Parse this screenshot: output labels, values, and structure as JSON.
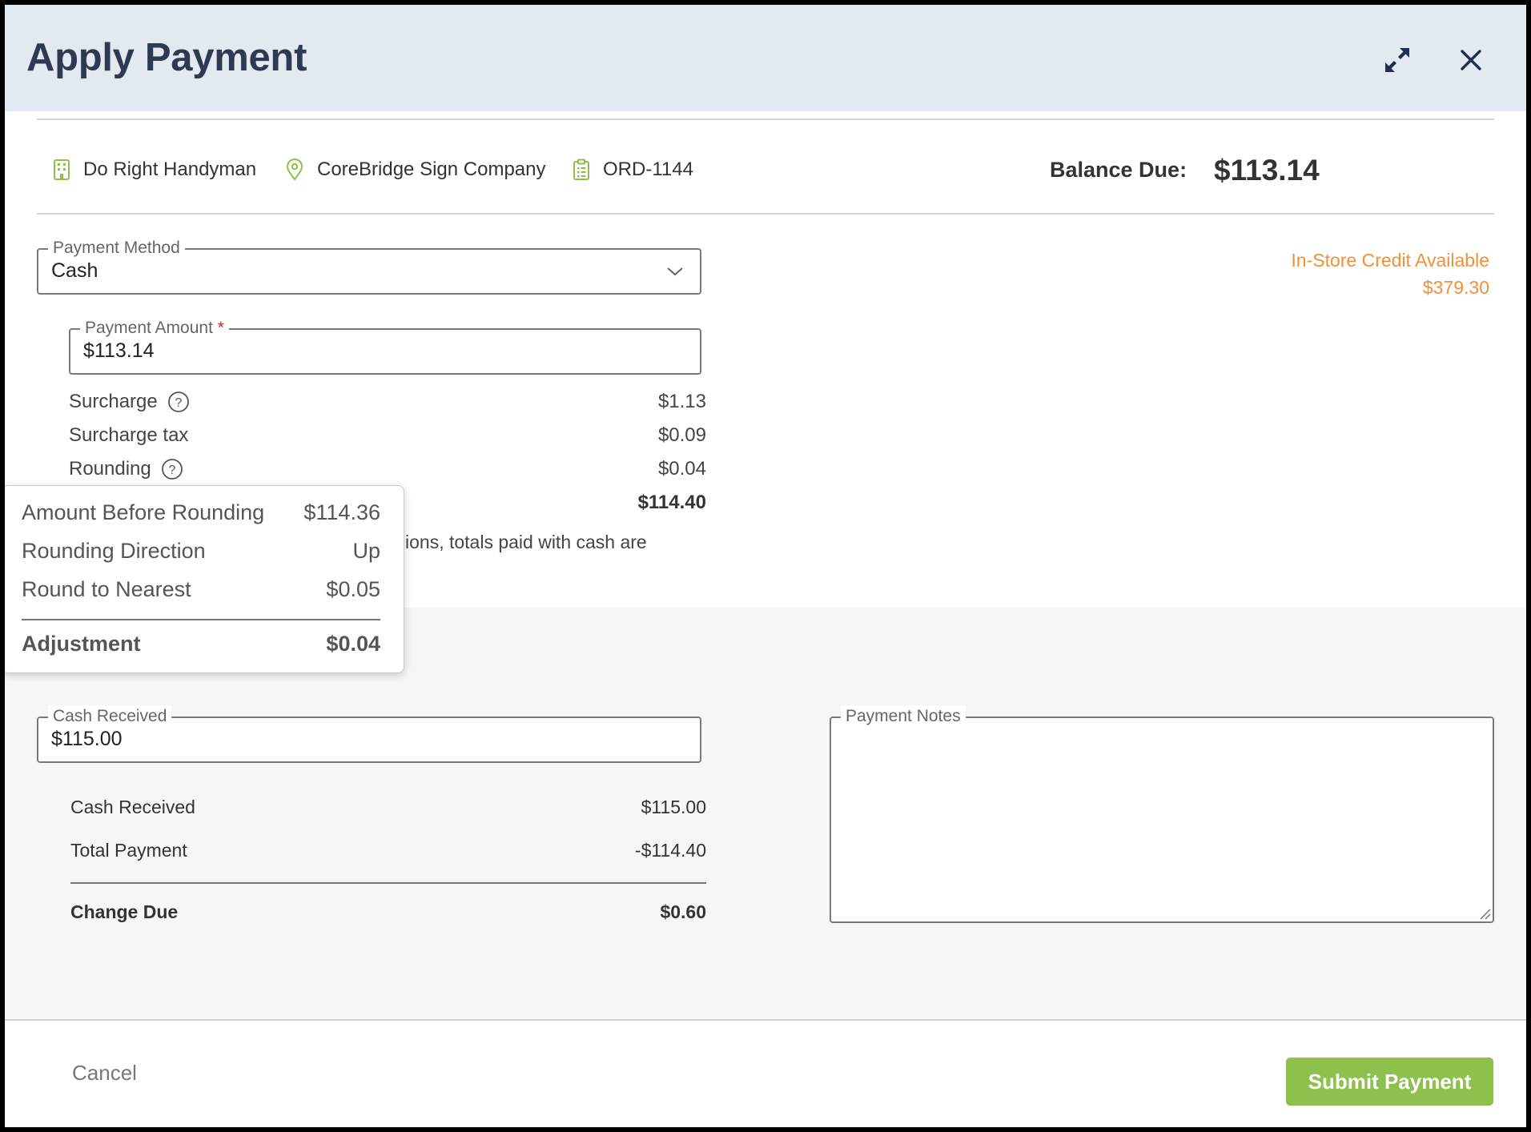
{
  "dialog": {
    "title": "Apply Payment"
  },
  "info": {
    "customer": "Do Right Handyman",
    "location": "CoreBridge Sign Company",
    "order": "ORD-1144",
    "balance_label": "Balance Due:",
    "balance_value": "$113.14"
  },
  "payment_method": {
    "label": "Payment Method",
    "value": "Cash"
  },
  "credit": {
    "label": "In-Store Credit Available",
    "value": "$379.30"
  },
  "payment_amount": {
    "label": "Payment Amount",
    "required_mark": "*",
    "value": "$113.14"
  },
  "breakdown": [
    {
      "label": "Surcharge",
      "value": "$1.13",
      "help": true
    },
    {
      "label": "Surcharge tax",
      "value": "$0.09",
      "help": false
    },
    {
      "label": "Rounding",
      "value": "$0.04",
      "help": true
    }
  ],
  "total_value": "$114.40",
  "disclaimer": "ions, totals paid with cash are",
  "rounding_popover": {
    "rows": [
      {
        "label": "Amount Before Rounding",
        "value": "$114.36"
      },
      {
        "label": "Rounding Direction",
        "value": "Up"
      },
      {
        "label": "Round to Nearest",
        "value": "$0.05"
      }
    ],
    "adjustment_label": "Adjustment",
    "adjustment_value": "$0.04"
  },
  "cash_received_field": {
    "label": "Cash Received",
    "value": "$115.00"
  },
  "payment_notes": {
    "label": "Payment Notes",
    "value": ""
  },
  "cash_summary": {
    "received_label": "Cash Received",
    "received_value": "$115.00",
    "total_label": "Total Payment",
    "total_value": "-$114.40",
    "change_label": "Change Due",
    "change_value": "$0.60"
  },
  "footer": {
    "cancel_label": "Cancel",
    "submit_label": "Submit Payment"
  },
  "colors": {
    "accent_green": "#8dc04d",
    "credit_orange": "#f0913a",
    "header_bg": "#e3e9f0",
    "title": "#2d3a4f"
  },
  "icons": {
    "expand": "expand-icon",
    "close": "close-icon",
    "customer": "building-icon",
    "location": "map-pin-icon",
    "order": "clipboard-icon",
    "dropdown": "chevron-down-icon",
    "help": "question-circle-icon",
    "resize": "resize-grip-icon"
  }
}
